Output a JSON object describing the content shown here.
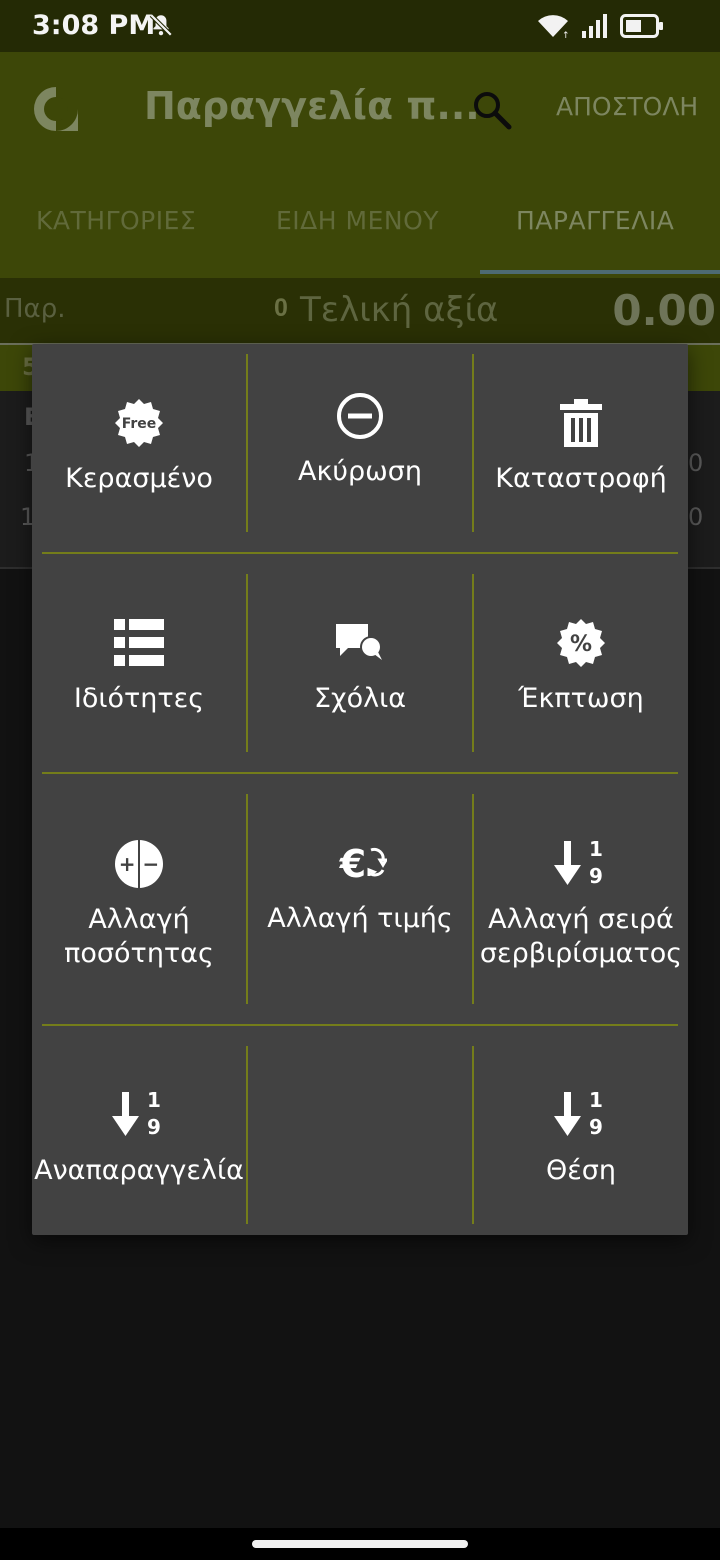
{
  "status_bar": {
    "time": "3:08 PM"
  },
  "app_bar": {
    "title": "Παραγγελία π...",
    "send_label": "ΑΠΟΣΤΟΛΗ"
  },
  "tabs": [
    "ΚΑΤΗΓΟΡΙΕΣ",
    "ΕΙΔΗ ΜΕΝΟΥ",
    "ΠΑΡΑΓΓΕΛΙΑ"
  ],
  "summary": {
    "par_label": "Παρ.",
    "count": "0",
    "total_label": "Τελική αξία",
    "total_value": "0.00"
  },
  "background_fragments": {
    "sub_left": "5",
    "row_a_left": "E",
    "row_b_left": "1",
    "row_c_left": "1",
    "row_b_right": "0",
    "row_c_right": "0"
  },
  "menu": {
    "items": [
      {
        "label": "Κερασμένο",
        "icon": "free-badge-icon",
        "badge_text": "Free"
      },
      {
        "label": "Ακύρωση",
        "icon": "cancel-minus-circle-icon"
      },
      {
        "label": "Καταστροφή",
        "icon": "trash-icon"
      },
      {
        "label": "Ιδιότητες",
        "icon": "list-icon"
      },
      {
        "label": "Σχόλια",
        "icon": "comments-icon"
      },
      {
        "label": "Έκπτωση",
        "icon": "discount-percent-icon",
        "badge_text": "%"
      },
      {
        "label": "Αλλαγή ποσότητας",
        "icon": "plus-minus-circle-icon",
        "badge_text": "+ −"
      },
      {
        "label": "Αλλαγή τιμής",
        "icon": "euro-exchange-icon",
        "badge_text": "€"
      },
      {
        "label": "Αλλαγή σειρά σερβιρίσματος",
        "icon": "sort-numeric-down-icon",
        "badge_top": "1",
        "badge_bottom": "9"
      },
      {
        "label": "Αναπαραγγελία",
        "icon": "sort-numeric-down-icon",
        "badge_top": "1",
        "badge_bottom": "9"
      },
      {
        "label": "Θέση",
        "icon": "sort-numeric-down-icon",
        "badge_top": "1",
        "badge_bottom": "9"
      }
    ]
  },
  "colors": {
    "dialog_bg": "#424242",
    "divider": "#747d1a",
    "appbar_dim": "#3d4708",
    "statusbar": "#242a05"
  }
}
